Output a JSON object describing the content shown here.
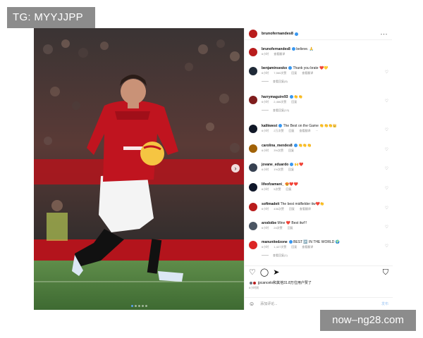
{
  "watermark_top": "TG: MYYJJPP",
  "watermark_bottom": "now–ng28.com",
  "post": {
    "author": "brunofernandes8",
    "more_icon": "more-icon",
    "photo": {
      "carousel_dots": 5,
      "active_dot": 0
    }
  },
  "comments": [
    {
      "user": "brunofernandes8",
      "text": "believe. 🙏",
      "meta": [
        "6小时",
        "查看翻译"
      ],
      "avatar_color": "#b91c1c",
      "verified": true,
      "heart": false
    },
    {
      "user": "benjaminsesko",
      "text": "Thank you brate ❤️💛",
      "meta": [
        "6小时",
        "7,560次赞",
        "回复",
        "查看翻译"
      ],
      "replies": "查看回复(8)",
      "avatar_color": "#1f2937",
      "verified": true,
      "heart": true
    },
    {
      "user": "harrymaguire93",
      "text": "👏👏",
      "meta": [
        "6小时",
        "2,466次赞",
        "回复"
      ],
      "replies": "查看回复(13)",
      "avatar_color": "#7f1d1d",
      "verified": true,
      "heart": true
    },
    {
      "user": "kalikwest",
      "text": "The Best on the Game 👏👏👏👑",
      "meta": [
        "6小时",
        "2万次赞",
        "回复",
        "查看翻译",
        "···"
      ],
      "avatar_color": "#111827",
      "verified": true,
      "heart": true
    },
    {
      "user": "carolina_mendes8",
      "text": "👏👏👏",
      "meta": [
        "6小时",
        "3%次赞",
        "回复"
      ],
      "avatar_color": "#a16207",
      "verified": true,
      "heart": true
    },
    {
      "user": "jovane_eduardo",
      "text": "🙌❤️",
      "meta": [
        "6小时",
        "1%次赞",
        "回复"
      ],
      "avatar_color": "#374151",
      "verified": true,
      "heart": true
    },
    {
      "user": "lifeofzamani_",
      "text": "😍❤️❤️",
      "meta": [
        "6小时",
        "5次赞",
        "回复"
      ],
      "avatar_color": "#0f172a",
      "verified": false,
      "heart": true
    },
    {
      "user": "softmadeit",
      "text": "The best midfielder itw❤️👏",
      "meta": [
        "6小时",
        "436次赞",
        "回复",
        "查看翻译"
      ],
      "avatar_color": "#b91c1c",
      "verified": false,
      "heart": true
    },
    {
      "user": "arodoibe",
      "text": "Mine ❤️ Best itw!!!",
      "meta": [
        "6小时",
        "24次赞",
        "回复"
      ],
      "avatar_color": "#4b5563",
      "verified": false,
      "heart": true
    },
    {
      "user": "manunitedzone",
      "text": "BEST 🆙 IN THE WORLD 🌍",
      "meta": [
        "6小时",
        "1,427次赞",
        "回复",
        "查看翻译"
      ],
      "replies": "查看回复(1)",
      "avatar_color": "#dc2626",
      "verified": true,
      "heart": true
    }
  ],
  "actions": {
    "like": "♡",
    "comment": "◯",
    "share": "➤",
    "save": "⛉"
  },
  "likes": {
    "text": "jpcancelo和其他31.8万位用户赞了",
    "time": "6小时前"
  },
  "add_comment": {
    "emoji": "☺",
    "placeholder": "添加评论...",
    "post_label": "发布"
  },
  "colors": {
    "accent": "#3897f0",
    "united_red": "#c8102e"
  }
}
